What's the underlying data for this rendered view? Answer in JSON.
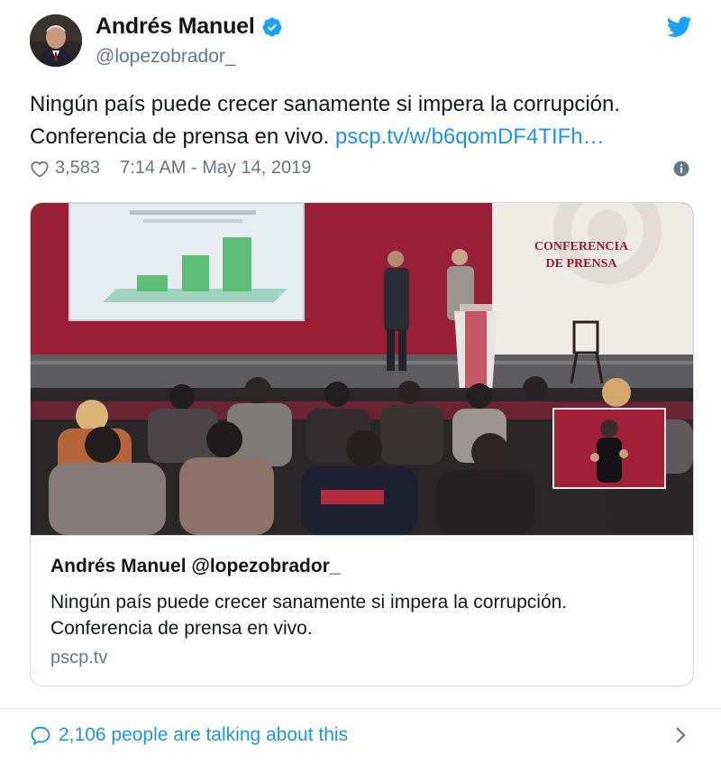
{
  "tweet": {
    "author": {
      "display_name": "Andrés Manuel",
      "handle": "@lopezobrador_",
      "verified": true
    },
    "text_plain": "Ningún país puede crecer sanamente si impera la corrupción. Conferencia de prensa en vivo.",
    "text_line1": "Ningún país puede crecer sanamente si impera la corrupción.",
    "text_line2": "Conferencia de prensa en vivo.",
    "text_link": "pscp.tv/w/b6qomDF4TIFh…",
    "likes": "3,583",
    "timestamp": "7:14 AM - May 14, 2019",
    "card": {
      "title": "Andrés Manuel @lopezobrador_",
      "description_line1": "Ningún país puede crecer sanamente si impera la corrupción.",
      "description_line2": "Conferencia de prensa en vivo.",
      "domain": "pscp.tv",
      "image_text_line1": "CONFERENCIA",
      "image_text_line2": "DE PRENSA"
    },
    "conversation": "2,106 people are talking about this"
  },
  "icons": {
    "brand": "twitter-bird-icon",
    "verified": "verified-badge-icon",
    "like": "heart-outline-icon",
    "info": "info-icon",
    "reply": "speech-bubble-icon",
    "chevron": "chevron-right-icon"
  },
  "colors": {
    "link": "#1b95e0",
    "text": "#14171a",
    "muted": "#657786",
    "border": "#ccd6dd",
    "stage_red": "#9b2335"
  }
}
